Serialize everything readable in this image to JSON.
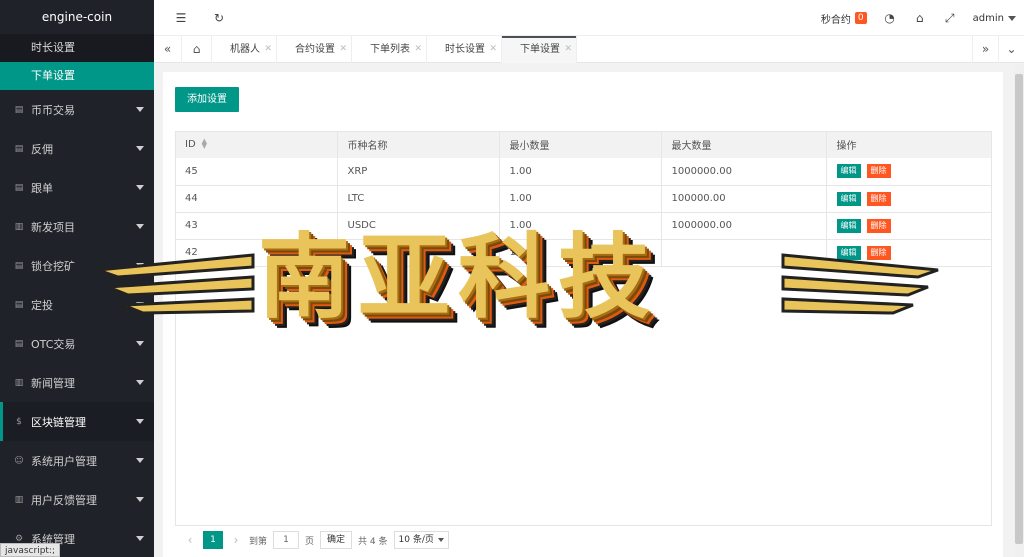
{
  "sidebar": {
    "logo": "engine-coin",
    "sub_items": [
      {
        "label": "时长设置",
        "active": false
      },
      {
        "label": "下单设置",
        "active": true
      }
    ],
    "items": [
      {
        "label": "币币交易",
        "icon": "doc-icon"
      },
      {
        "label": "反佣",
        "icon": "doc-icon"
      },
      {
        "label": "跟单",
        "icon": "doc-icon"
      },
      {
        "label": "新发项目",
        "icon": "news-icon"
      },
      {
        "label": "锁仓挖矿",
        "icon": "doc-icon"
      },
      {
        "label": "定投",
        "icon": "doc-icon"
      },
      {
        "label": "OTC交易",
        "icon": "doc-icon"
      },
      {
        "label": "新闻管理",
        "icon": "news-icon"
      },
      {
        "label": "区块链管理",
        "icon": "dollar-icon",
        "selected": true
      },
      {
        "label": "系统用户管理",
        "icon": "user-icon"
      },
      {
        "label": "用户反馈管理",
        "icon": "news-icon"
      },
      {
        "label": "系统管理",
        "icon": "gear-icon"
      }
    ],
    "status_tip": "javascript:;"
  },
  "header": {
    "seconds_contract": "秒合约",
    "badge": "0",
    "user": "admin"
  },
  "tabs": [
    {
      "label": "机器人",
      "active": false
    },
    {
      "label": "合约设置",
      "active": false
    },
    {
      "label": "下单列表",
      "active": false
    },
    {
      "label": "时长设置",
      "active": false
    },
    {
      "label": "下单设置",
      "active": true
    }
  ],
  "content": {
    "add_button": "添加设置",
    "columns": [
      "ID",
      "币种名称",
      "最小数量",
      "最大数量",
      "操作"
    ],
    "rows": [
      {
        "id": "45",
        "name": "XRP",
        "min": "1.00",
        "max": "1000000.00"
      },
      {
        "id": "44",
        "name": "LTC",
        "min": "1.00",
        "max": "100000.00"
      },
      {
        "id": "43",
        "name": "USDC",
        "min": "1.00",
        "max": "1000000.00"
      },
      {
        "id": "42",
        "name": "",
        "min": "1.00",
        "max": ""
      }
    ],
    "edit_label": "编辑",
    "delete_label": "删除"
  },
  "pager": {
    "current": "1",
    "goto_label": "到第",
    "goto_value": "1",
    "page_suffix": "页",
    "confirm": "确定",
    "total": "共 4 条",
    "page_size": "10 条/页"
  },
  "watermark": "南亚科技",
  "colors": {
    "accent": "#009688",
    "danger": "#ff5722",
    "sidebar": "#20222a"
  }
}
